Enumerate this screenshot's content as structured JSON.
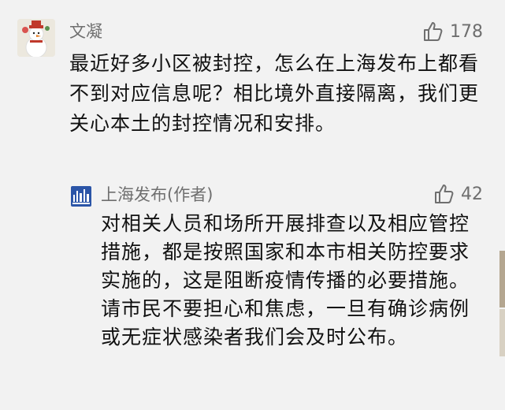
{
  "comment": {
    "username": "文凝",
    "like_count": "178",
    "text": "最近好多小区被封控，怎么在上海发布上都看不到对应信息呢？相比境外直接隔离，我们更关心本土的封控情况和安排。"
  },
  "reply": {
    "username": "上海发布(作者)",
    "like_count": "42",
    "text": "对相关人员和场所开展排查以及相应管控措施，都是按照国家和本市相关防控要求实施的，这是阻断疫情传播的必要措施。请市民不要担心和焦虑，一旦有确诊病例或无症状感染者我们会及时公布。"
  },
  "icons": {
    "like": "thumbs-up-outline-icon",
    "avatar": "snowman-avatar",
    "reply_avatar": "shanghai-fabu-logo"
  },
  "colors": {
    "background": "#f2f2f2",
    "secondary_text": "#6f6f6f",
    "primary_text": "#111111",
    "logo_blue": "#2b55a7"
  }
}
